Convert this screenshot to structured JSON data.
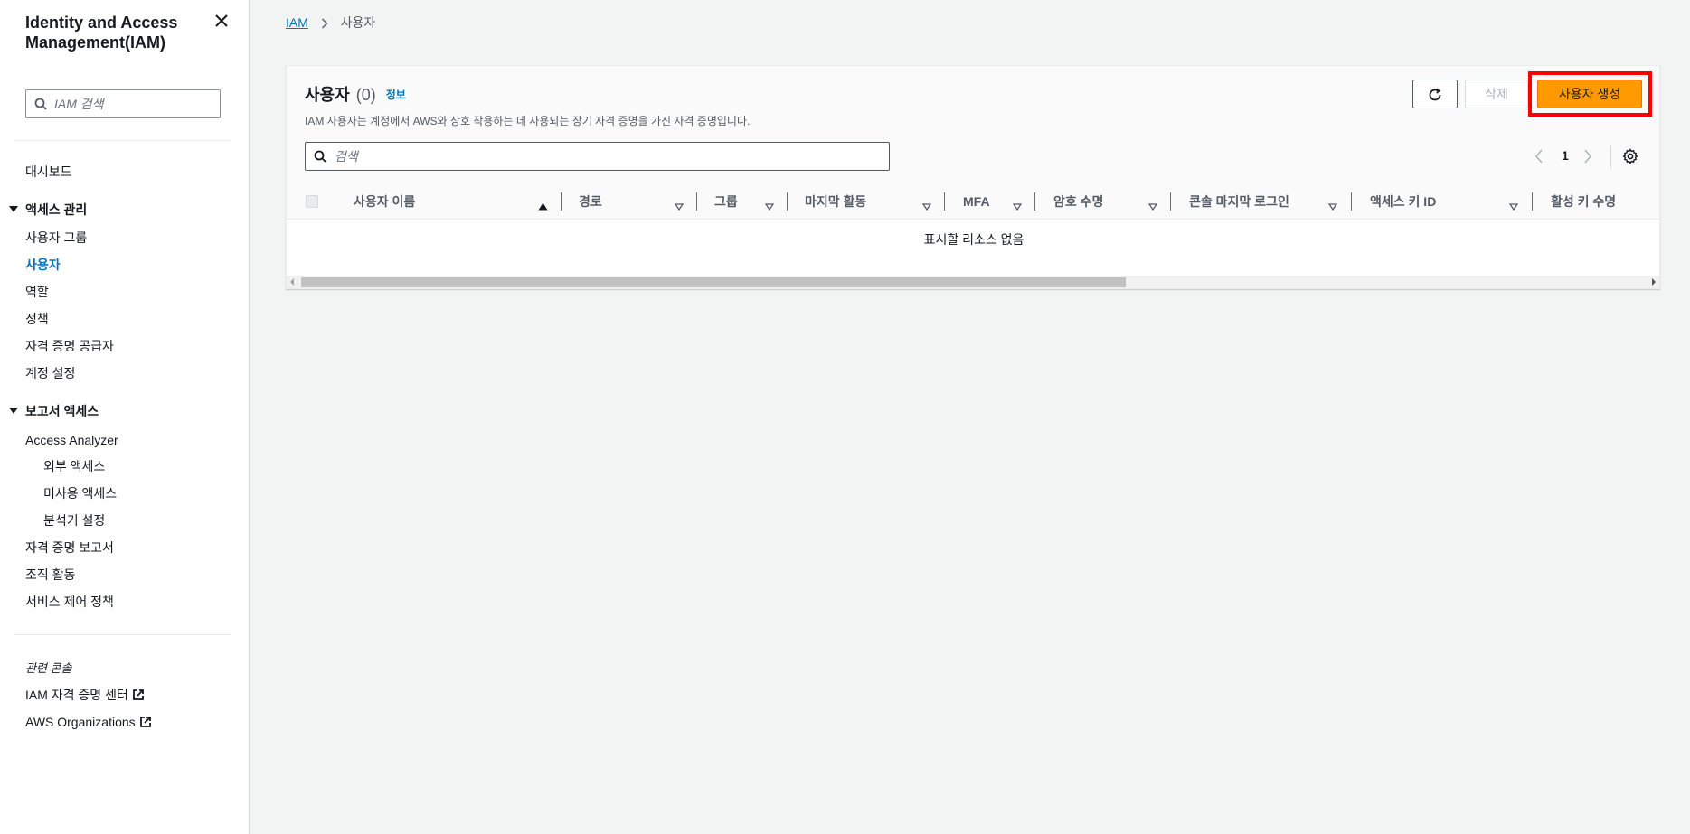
{
  "sidebar": {
    "title": "Identity and Access Management(IAM)",
    "close_icon": "close-icon",
    "search_placeholder": "IAM 검색",
    "dashboard": "대시보드",
    "access_mgmt": {
      "label": "액세스 관리",
      "items": [
        "사용자 그룹",
        "사용자",
        "역할",
        "정책",
        "자격 증명 공급자",
        "계정 설정"
      ],
      "active": "사용자"
    },
    "reports": {
      "label": "보고서 액세스",
      "access_analyzer": "Access Analyzer",
      "analyzer_items": [
        "외부 액세스",
        "미사용 액세스",
        "분석기 설정"
      ],
      "items": [
        "자격 증명 보고서",
        "조직 활동",
        "서비스 제어 정책"
      ]
    },
    "related_label": "관련 콘솔",
    "related_links": [
      "IAM 자격 증명 센터",
      "AWS Organizations"
    ]
  },
  "breadcrumb": {
    "root": "IAM",
    "current": "사용자"
  },
  "panel": {
    "title": "사용자",
    "count": "(0)",
    "info": "정보",
    "description": "IAM 사용자는 계정에서 AWS와 상호 작용하는 데 사용되는 장기 자격 증명을 가진 자격 증명입니다.",
    "buttons": {
      "delete": "삭제",
      "create": "사용자 생성"
    },
    "search_placeholder": "검색",
    "page": "1",
    "columns": [
      "사용자 이름",
      "경로",
      "그룹",
      "마지막 활동",
      "MFA",
      "암호 수명",
      "콘솔 마지막 로그인",
      "액세스 키 ID",
      "활성 키 수명"
    ],
    "empty_message": "표시할 리소스 없음"
  },
  "colors": {
    "accent": "#0073bb",
    "primary_button": "#ff9900",
    "highlight": "#ff0000"
  }
}
